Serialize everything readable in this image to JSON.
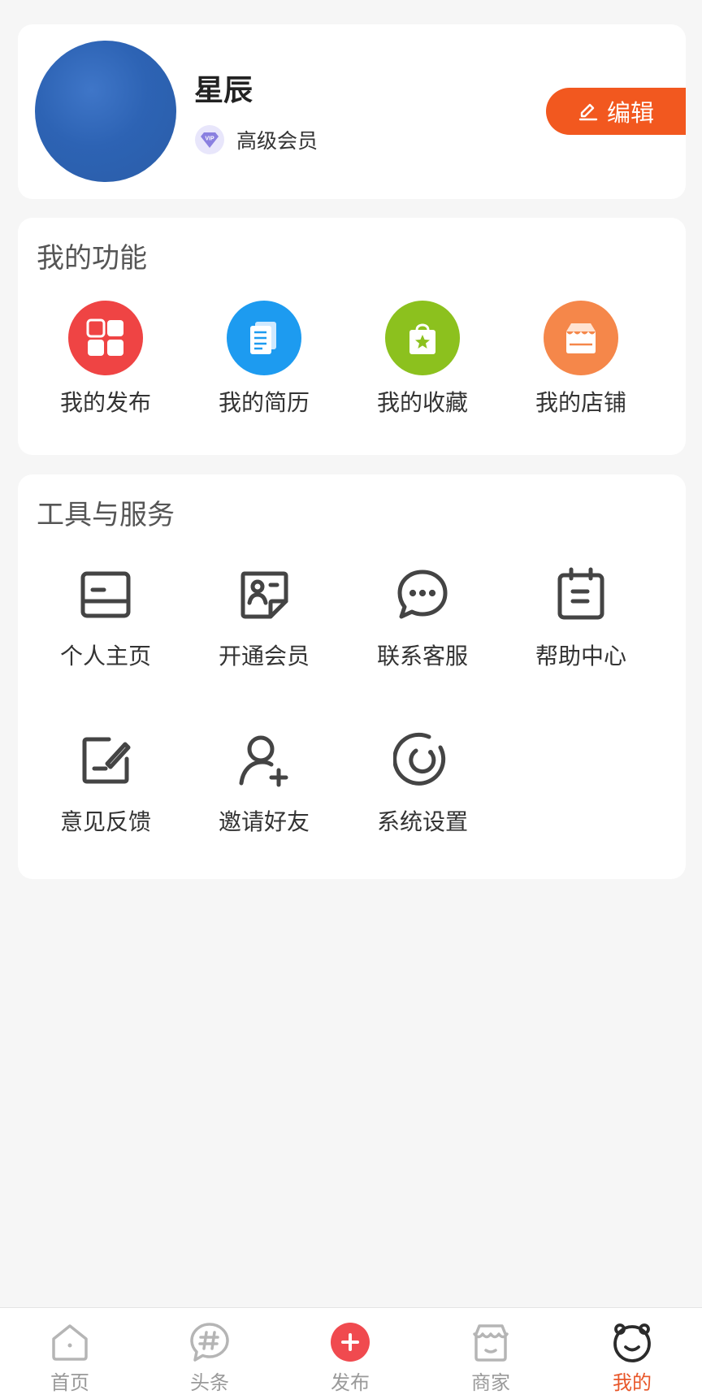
{
  "profile": {
    "name": "星辰",
    "membership": "高级会员",
    "vip_badge_text": "VIP",
    "edit_label": "编辑"
  },
  "functions": {
    "title": "我的功能",
    "items": [
      {
        "label": "我的发布",
        "icon": "grid-icon",
        "color": "#ef4444"
      },
      {
        "label": "我的简历",
        "icon": "document-icon",
        "color": "#1d9bf0"
      },
      {
        "label": "我的收藏",
        "icon": "shopping-bag-star-icon",
        "color": "#8cc11e"
      },
      {
        "label": "我的店铺",
        "icon": "store-icon",
        "color": "#f5874a"
      }
    ]
  },
  "tools": {
    "title": "工具与服务",
    "items": [
      {
        "label": "个人主页",
        "icon": "card-icon"
      },
      {
        "label": "开通会员",
        "icon": "member-card-icon"
      },
      {
        "label": "联系客服",
        "icon": "chat-bubble-icon"
      },
      {
        "label": "帮助中心",
        "icon": "clipboard-icon"
      },
      {
        "label": "意见反馈",
        "icon": "edit-square-icon"
      },
      {
        "label": "邀请好友",
        "icon": "add-user-icon"
      },
      {
        "label": "系统设置",
        "icon": "settings-ring-icon"
      }
    ]
  },
  "bottom_nav": {
    "items": [
      {
        "label": "首页",
        "icon": "home-icon"
      },
      {
        "label": "头条",
        "icon": "hashtag-bubble-icon"
      },
      {
        "label": "发布",
        "icon": "plus-circle-icon"
      },
      {
        "label": "商家",
        "icon": "shop-icon"
      },
      {
        "label": "我的",
        "icon": "face-icon"
      }
    ],
    "active": "我的",
    "active_color": "#e8572a"
  },
  "colors": {
    "accent": "#f2581f",
    "background": "#f6f6f6",
    "icon_stroke": "#444444"
  }
}
